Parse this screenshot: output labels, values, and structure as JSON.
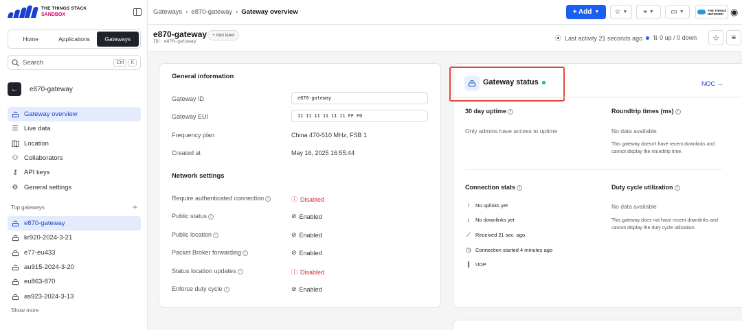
{
  "logo": {
    "line1": "THE THINGS STACK",
    "line2": "SANDBOX"
  },
  "switcher": {
    "home": "Home",
    "applications": "Applications",
    "gateways": "Gateways"
  },
  "search": {
    "placeholder": "Search",
    "kbd1": "Ctrl",
    "kbd2": "K"
  },
  "back": {
    "title": "e870-gateway"
  },
  "nav": [
    {
      "label": "Gateway overview",
      "icon": "gateway-icon"
    },
    {
      "label": "Live data",
      "icon": "list-icon"
    },
    {
      "label": "Location",
      "icon": "map-icon"
    },
    {
      "label": "Collaborators",
      "icon": "users-icon"
    },
    {
      "label": "API keys",
      "icon": "key-icon"
    },
    {
      "label": "General settings",
      "icon": "gear-icon"
    }
  ],
  "top_gateways": {
    "heading": "Top gateways",
    "items": [
      "e870-gateway",
      "kr920-2024-3-21",
      "e77-eu433",
      "au915-2024-3-20",
      "eu863-870",
      "as923-2024-3-13"
    ],
    "show_more": "Show more"
  },
  "breadcrumb": {
    "c1": "Gateways",
    "c2": "e870-gateway",
    "c3": "Gateway overview"
  },
  "toolbar": {
    "add": "+ Add",
    "cloud_text1": "THE THINGS",
    "cloud_text2": "NETWORK"
  },
  "header": {
    "title": "e870-gateway",
    "id": "ID: e870-gateway",
    "add_label": "+ Add label",
    "activity": "Last activity 21 seconds ago",
    "updown": "⇅ 0 up / 0 down"
  },
  "general": {
    "title": "General information",
    "gateway_id_label": "Gateway ID",
    "gateway_id": "e870-gateway",
    "gateway_eui_label": "Gateway EUI",
    "gateway_eui": "11 11 11 11 11 11 FF F0",
    "freq_label": "Frequency plan",
    "freq": "China 470-510 MHz, FSB 1",
    "created_label": "Created at",
    "created": "May 16, 2025 16:55:44"
  },
  "network": {
    "title": "Network settings",
    "rows": [
      {
        "label": "Require authenticated connection",
        "value": "Disabled"
      },
      {
        "label": "Public status",
        "value": "Enabled"
      },
      {
        "label": "Public location",
        "value": "Enabled"
      },
      {
        "label": "Packet Broker forwarding",
        "value": "Enabled"
      },
      {
        "label": "Status location updates",
        "value": "Disabled"
      },
      {
        "label": "Enforce duty cycle",
        "value": "Enabled"
      }
    ]
  },
  "status": {
    "title": "Gateway status",
    "noc": "NOC →",
    "uptime_title": "30 day uptime",
    "uptime_text": "Only admins have access to uptime",
    "roundtrip_title": "Roundtrip times (ms)",
    "roundtrip_nodata": "No data available",
    "roundtrip_note": "This gateway doesn't have recent downlinks and cannot display the roundtrip time.",
    "conn_title": "Connection stats",
    "conn_uplinks": "No uplinks yet",
    "conn_downlinks": "No downlinks yet",
    "conn_received": "Received  21 sec. ago",
    "conn_started": "Connection started 4 minutes ago",
    "conn_proto": "UDP",
    "duty_title": "Duty cycle utilization",
    "duty_nodata": "No data available",
    "duty_note": "This gateway does not have recent downlinks and cannot display the duty cycle utilization."
  },
  "colors": {
    "accent": "#1b5ff0",
    "brand": "#1a3fd1",
    "sandbox": "#d4006a",
    "ok": "#1fb85a",
    "error": "#d32f2f",
    "highlight": "#e0483a"
  }
}
